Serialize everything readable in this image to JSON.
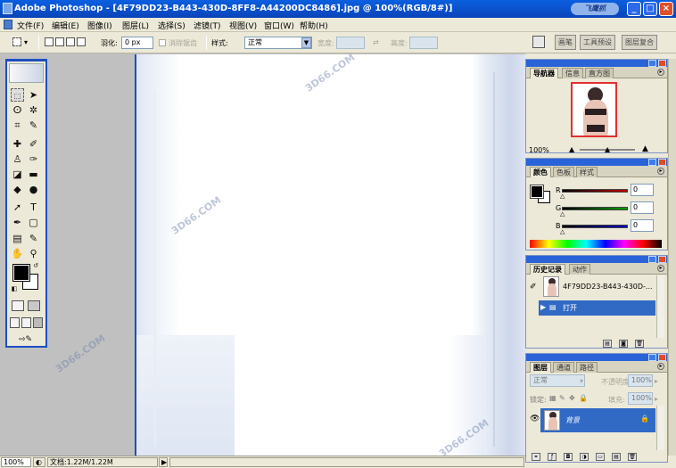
{
  "window": {
    "title": "Adobe Photoshop - [4F79DD23-B443-430D-8FF8-A44200DC8486].jpg @ 100%(RGB/8#)]",
    "logo_text": "飞鹰抓",
    "btn_min": "_",
    "btn_max": "□",
    "btn_close": "×"
  },
  "menu": [
    "文件(F)",
    "编辑(E)",
    "图像(I)",
    "图层(L)",
    "选择(S)",
    "滤镜(T)",
    "视图(V)",
    "窗口(W)",
    "帮助(H)"
  ],
  "options": {
    "feather_label": "羽化:",
    "feather_value": "0 px",
    "antialias_label": "消除锯齿",
    "style_label": "样式:",
    "style_value": "正常",
    "width_label": "宽度:",
    "height_label": "高度:",
    "well_tabs": [
      "画笔",
      "工具预设",
      "图层复合"
    ]
  },
  "status": {
    "zoom": "100%",
    "doc_info": "文档:1.22M/1.22M",
    "arrow": "▶"
  },
  "navigator": {
    "tabs": [
      "导航器",
      "信息",
      "直方图"
    ],
    "zoom": "100%"
  },
  "color_panel": {
    "tabs": [
      "颜色",
      "色板",
      "样式"
    ],
    "channels": [
      {
        "label": "R",
        "value": "0",
        "color": "#c00000"
      },
      {
        "label": "G",
        "value": "0",
        "color": "#00a000"
      },
      {
        "label": "B",
        "value": "0",
        "color": "#0000c8"
      }
    ]
  },
  "history": {
    "tabs": [
      "历史记录",
      "动作"
    ],
    "snapshot_name": "4F79DD23-B443-430D-...",
    "items": [
      "打开"
    ]
  },
  "layers": {
    "tabs": [
      "图层",
      "通道",
      "路径"
    ],
    "blend_mode": "正常",
    "opacity_label": "不透明度:",
    "opacity_value": "100%",
    "lock_label": "锁定:",
    "fill_label": "填充:",
    "fill_value": "100%",
    "layer_name": "背景"
  },
  "watermarks": [
    "3D66.COM",
    "3D66.COM",
    "3D66.COM",
    "3D66.COM",
    "3D66.COM",
    "3D66.COM"
  ],
  "colors": {
    "accent": "#1d4fc2",
    "selection": "#316ac5",
    "titlebar": "#0b4fc9"
  }
}
